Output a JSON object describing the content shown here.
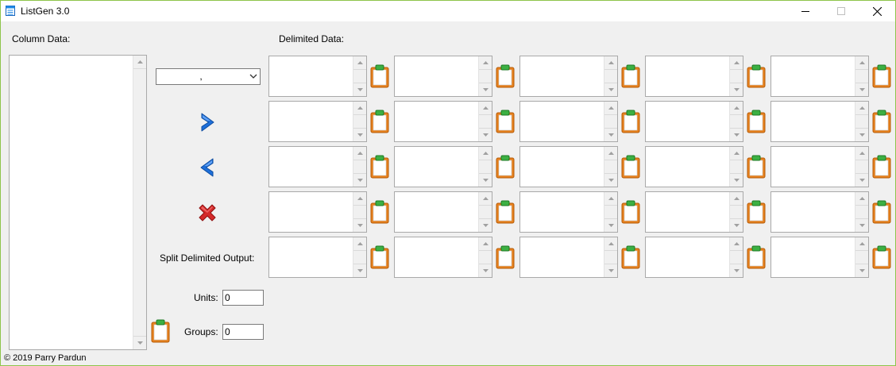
{
  "window": {
    "title": "ListGen 3.0",
    "minimize_icon": "minimize-icon",
    "maximize_icon": "maximize-icon",
    "close_icon": "close-icon"
  },
  "labels": {
    "column_data": "Column Data:",
    "delimited_data": "Delimited Data:",
    "split_output": "Split Delimited Output:",
    "units": "Units:",
    "groups": "Groups:"
  },
  "delimiter": {
    "selected": ","
  },
  "actions": {
    "to_delimited_icon": "chevron-right-icon",
    "to_column_icon": "chevron-left-icon",
    "clear_icon": "red-x-icon"
  },
  "inputs": {
    "units": "0",
    "groups": "0"
  },
  "column_text": "",
  "delimited_grid": {
    "rows": 5,
    "cols": 5
  },
  "footer": "© 2019 Parry Pardun",
  "colors": {
    "window_bg": "#f0f0f0",
    "border_accent": "#8ec44b",
    "arrow_blue": "#1e6fd9",
    "clear_red": "#d42a2a",
    "clipboard_orange": "#e8821e"
  }
}
